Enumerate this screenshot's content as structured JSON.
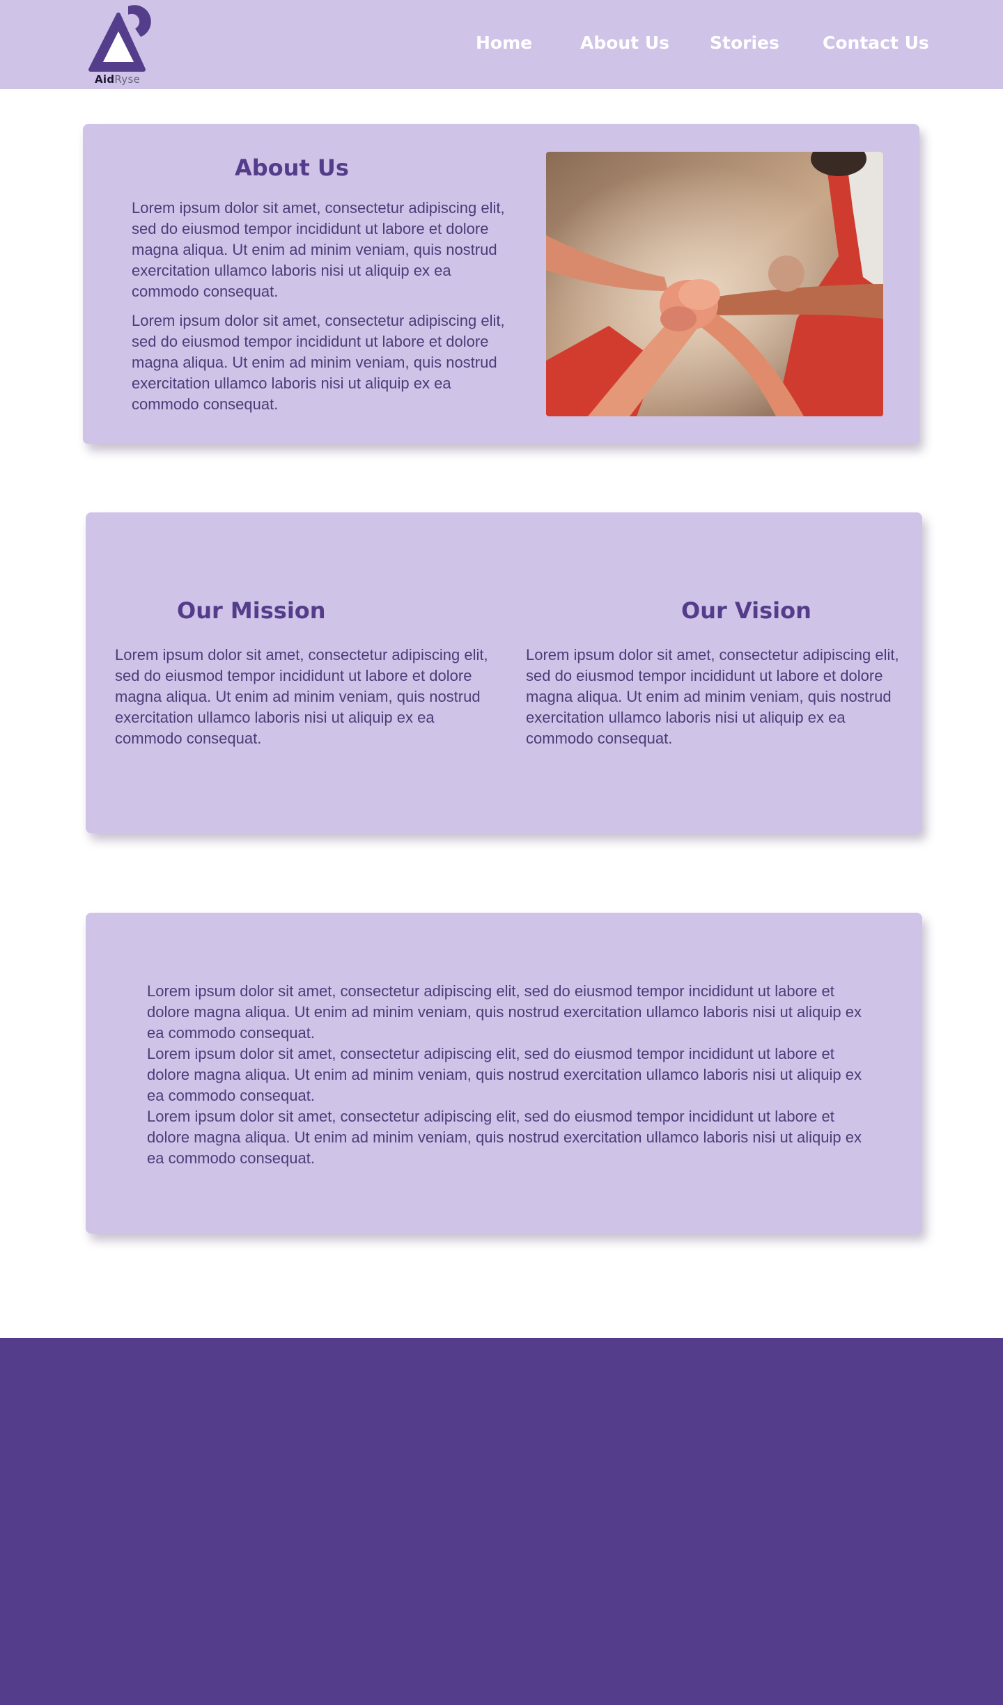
{
  "brand": {
    "logo_text_bold": "Aid",
    "logo_text_light": "Ryse",
    "primary_color": "#543d8b",
    "light_color": "#cfc3e8"
  },
  "nav": {
    "items": [
      {
        "label": "Home"
      },
      {
        "label": "About Us"
      },
      {
        "label": "Stories"
      },
      {
        "label": "Contact Us"
      }
    ]
  },
  "about": {
    "title": "About Us",
    "paragraphs": [
      "Lorem ipsum dolor sit amet, consectetur adipiscing elit, sed do eiusmod tempor incididunt ut labore et dolore magna aliqua. Ut enim ad minim veniam, quis nostrud exercitation ullamco laboris nisi ut aliquip ex ea commodo consequat.",
      "Lorem ipsum dolor sit amet, consectetur adipiscing elit, sed do eiusmod tempor incididunt ut labore et dolore magna aliqua. Ut enim ad minim veniam, quis nostrud exercitation ullamco laboris nisi ut aliquip ex ea commodo consequat."
    ]
  },
  "mission": {
    "title": "Our Mission",
    "text": "Lorem ipsum dolor sit amet, consectetur adipiscing elit, sed do eiusmod tempor incididunt ut labore et dolore magna aliqua. Ut enim ad minim veniam, quis nostrud exercitation ullamco laboris nisi ut aliquip ex ea commodo consequat."
  },
  "vision": {
    "title": "Our Vision",
    "text": "Lorem ipsum dolor sit amet, consectetur adipiscing elit, sed do eiusmod tempor incididunt ut labore et dolore magna aliqua. Ut enim ad minim veniam, quis nostrud exercitation ullamco laboris nisi ut aliquip ex ea commodo consequat."
  },
  "story": {
    "paragraphs": [
      "Lorem ipsum dolor sit amet, consectetur adipiscing elit, sed do eiusmod tempor incididunt ut labore et dolore magna aliqua. Ut enim ad minim veniam, quis nostrud exercitation ullamco laboris nisi ut aliquip ex ea commodo consequat.",
      "Lorem ipsum dolor sit amet, consectetur adipiscing elit, sed do eiusmod tempor incididunt ut labore et dolore magna aliqua. Ut enim ad minim veniam, quis nostrud exercitation ullamco laboris nisi ut aliquip ex ea commodo consequat.",
      "Lorem ipsum dolor sit amet, consectetur adipiscing elit, sed do eiusmod tempor incididunt ut labore et dolore magna aliqua. Ut enim ad minim veniam, quis nostrud exercitation ullamco laboris nisi ut aliquip ex ea commodo consequat."
    ]
  }
}
